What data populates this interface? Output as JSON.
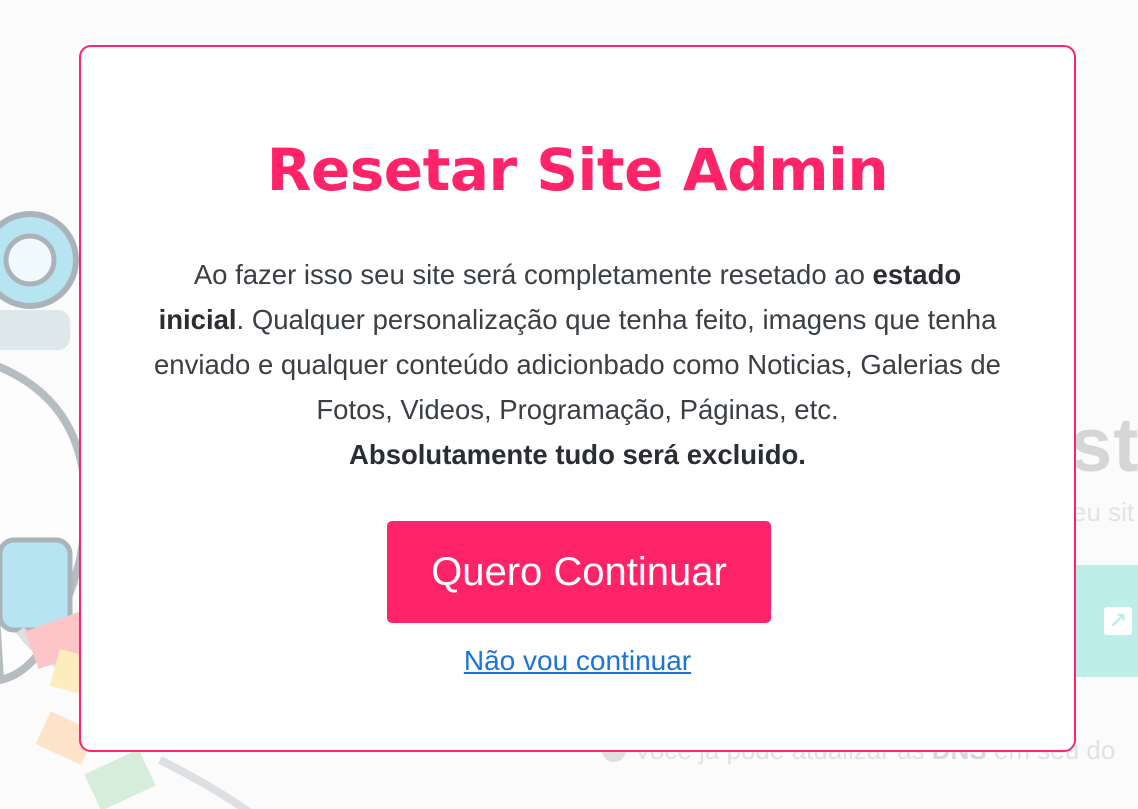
{
  "modal": {
    "title": "Resetar Site Admin",
    "text_part1": "Ao fazer isso seu site será completamente resetado ao ",
    "text_bold1": "estado inicial",
    "text_part2": ". Qualquer personalização que tenha feito, imagens que tenha enviado e qualquer conteúdo adicionbado como Noticias, Galerias de Fotos, Videos, Programação, Páginas, etc.",
    "text_bold2": "Absolutamente tudo será excluido.",
    "continue_label": "Quero Continuar",
    "cancel_label": "Não vou continuar"
  },
  "background": {
    "heading_fragment": "str",
    "subtext_fragment": "eu sit",
    "footnote_part1": "Você já pode atualizar as ",
    "footnote_bold": "DNS",
    "footnote_part2": " em seu do"
  },
  "colors": {
    "accent": "#ff2369",
    "link": "#1a73d9",
    "text": "#3a3f44",
    "tile": "#bdeee9"
  },
  "icons": {
    "tile_icon": "external-link-icon",
    "footnote_icon": "info-icon"
  }
}
